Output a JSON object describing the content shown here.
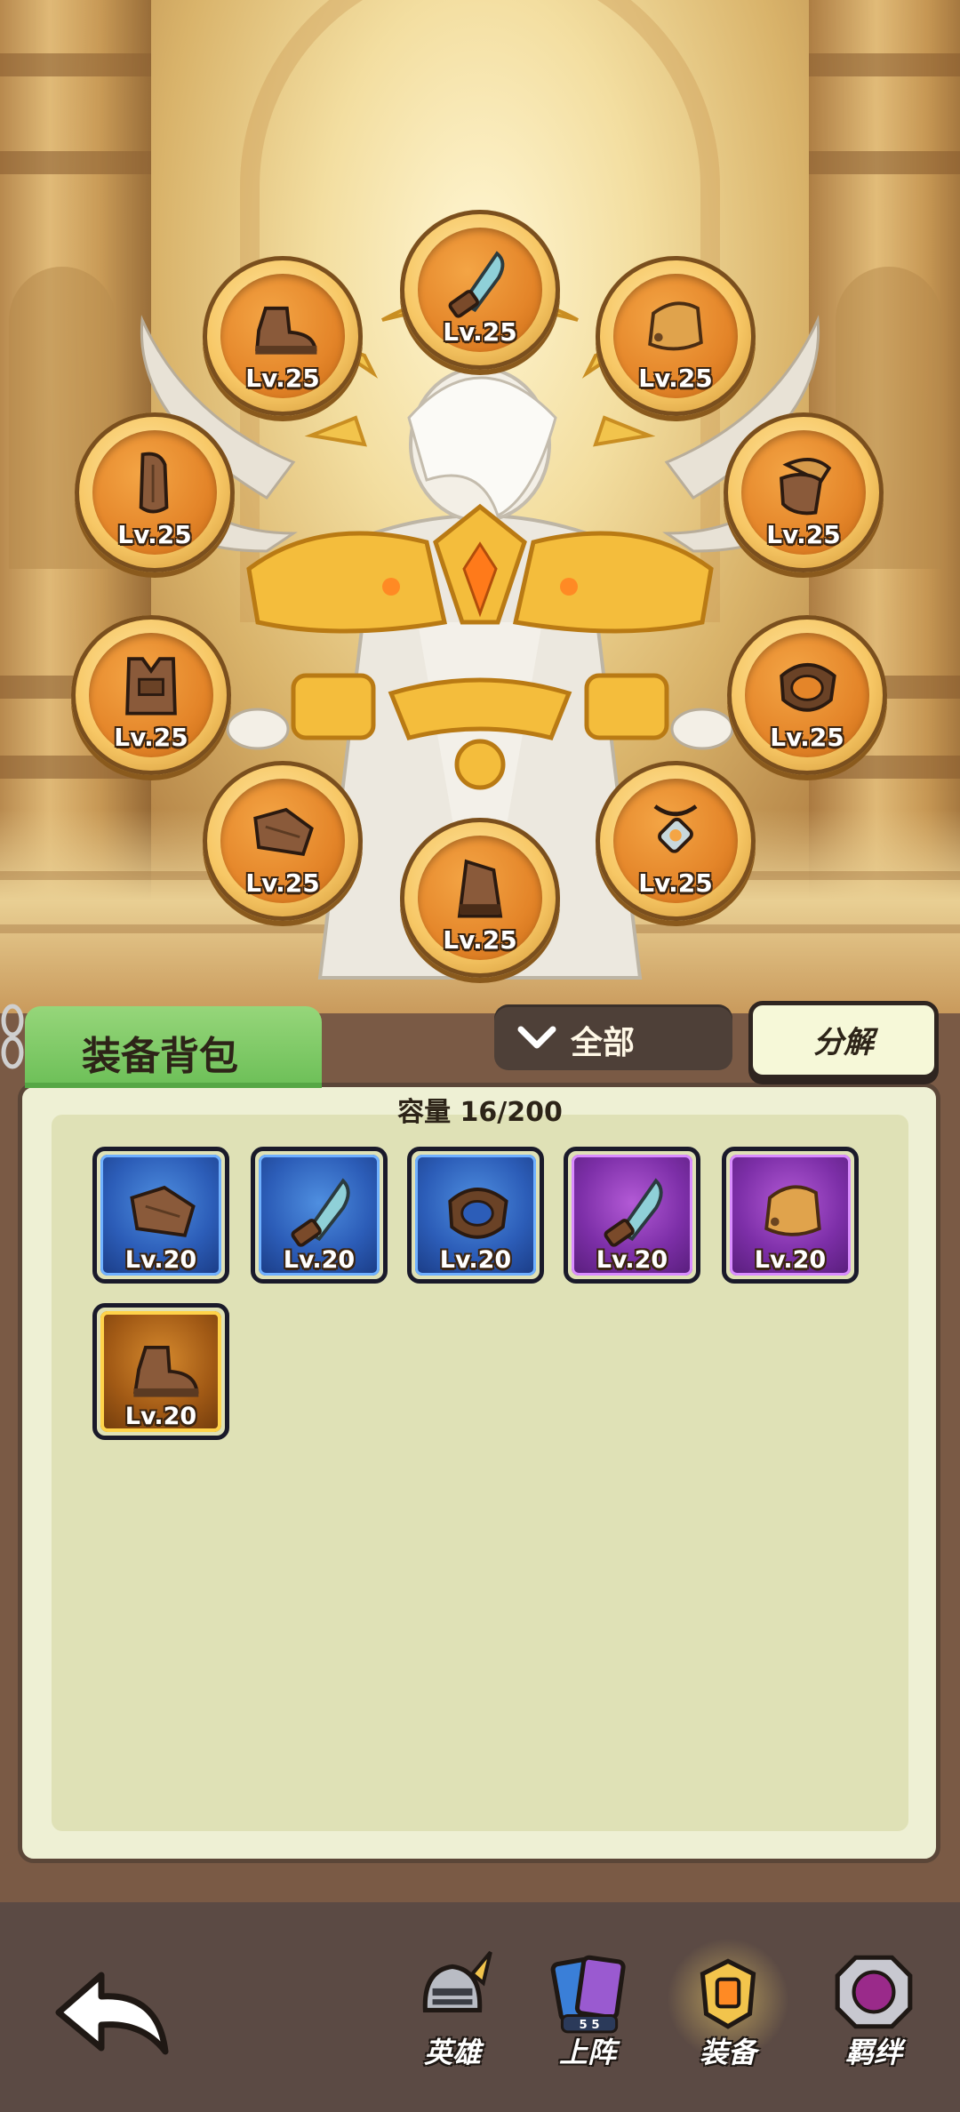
{
  "hero_slots": [
    {
      "name": "weapon-slot",
      "icon": "dagger-icon",
      "level": "Lv.25"
    },
    {
      "name": "boots-slot",
      "icon": "boots-icon",
      "level": "Lv.25"
    },
    {
      "name": "bracer-slot",
      "icon": "bracer-icon",
      "level": "Lv.25"
    },
    {
      "name": "pauldron-slot",
      "icon": "pauldron-icon",
      "level": "Lv.25"
    },
    {
      "name": "gauntlet-slot",
      "icon": "gauntlet-icon",
      "level": "Lv.25"
    },
    {
      "name": "chest-slot",
      "icon": "chest-armor-icon",
      "level": "Lv.25"
    },
    {
      "name": "belt-slot",
      "icon": "belt-icon",
      "level": "Lv.25"
    },
    {
      "name": "leg-slot",
      "icon": "leg-armor-icon",
      "level": "Lv.25"
    },
    {
      "name": "amulet-slot",
      "icon": "amulet-icon",
      "level": "Lv.25"
    },
    {
      "name": "hood-slot",
      "icon": "hood-icon",
      "level": "Lv.25"
    }
  ],
  "bag": {
    "tab_label": "装备背包",
    "filter_label": "全部",
    "decompose_label": "分解",
    "capacity_text": "容量 16/200",
    "items": [
      {
        "rarity": "blue",
        "icon": "leg-armor-icon",
        "level": "Lv.20"
      },
      {
        "rarity": "blue",
        "icon": "dagger-icon",
        "level": "Lv.20"
      },
      {
        "rarity": "blue",
        "icon": "belt-icon",
        "level": "Lv.20"
      },
      {
        "rarity": "purple",
        "icon": "dagger-icon",
        "level": "Lv.20"
      },
      {
        "rarity": "purple",
        "icon": "bracer-icon",
        "level": "Lv.20"
      },
      {
        "rarity": "gold",
        "icon": "boots-icon",
        "level": "Lv.20"
      }
    ]
  },
  "nav": {
    "items": [
      {
        "label": "英雄",
        "icon": "knight-helmet-icon",
        "badge": ""
      },
      {
        "label": "上阵",
        "icon": "deploy-cards-icon",
        "badge": "5 5"
      },
      {
        "label": "装备",
        "icon": "equipment-icon",
        "badge": ""
      },
      {
        "label": "羁绊",
        "icon": "bond-emblem-icon",
        "badge": ""
      }
    ]
  },
  "colors": {
    "green_tab": "#6cbf57",
    "panel": "#eef0d4",
    "rarity_blue": "#2c5db8",
    "rarity_purple": "#7d2fa8",
    "rarity_gold": "#ffd34a"
  }
}
